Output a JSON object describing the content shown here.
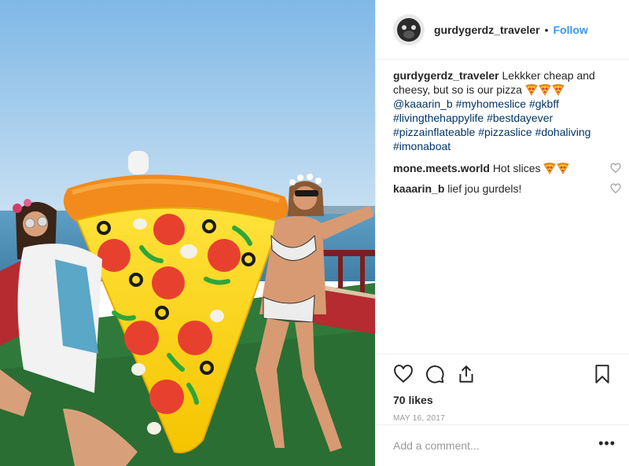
{
  "post": {
    "image_alt": "Two women on a boat deck with a giant inflatable pizza slice"
  },
  "header": {
    "username": "gurdygerdz_traveler",
    "separator": "•",
    "follow_label": "Follow"
  },
  "caption": {
    "username": "gurdygerdz_traveler",
    "text": "Lekkker cheap and cheesy, but so is our pizza",
    "emoji_count": 3,
    "emoji_icon": "pizza-emoji",
    "mention": "@kaaarin_b",
    "hashtags": [
      "#myhomeslice",
      "#gkbff",
      "#livingthehappylife",
      "#bestdayever",
      "#pizzainflateable",
      "#pizzaslice",
      "#dohaliving",
      "#imonaboat"
    ]
  },
  "comments": [
    {
      "username": "mone.meets.world",
      "text": "Hot slices",
      "emoji_count": 2
    },
    {
      "username": "kaaarin_b",
      "text": "lief jou gurdels!",
      "emoji_count": 0
    }
  ],
  "actions": {
    "icons": [
      "heart-icon",
      "comment-icon",
      "share-icon",
      "bookmark-icon"
    ],
    "likes": "70 likes",
    "date": "MAY 16, 2017"
  },
  "add_comment": {
    "placeholder": "Add a comment...",
    "more_label": "•••"
  },
  "colors": {
    "link": "#003569",
    "follow": "#3897f0",
    "text": "#262626",
    "muted": "#999999",
    "divider": "#efefef"
  }
}
